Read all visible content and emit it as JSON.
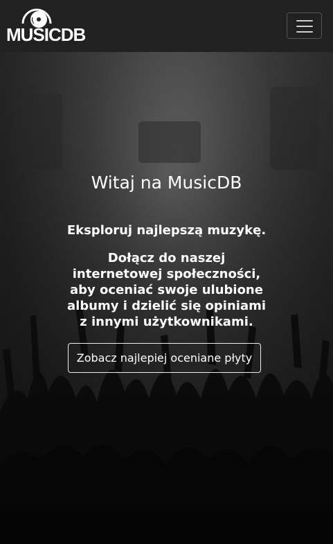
{
  "navbar": {
    "brand_text": "MUSICDB",
    "logo_icon": "vinyl-record-icon",
    "menu_icon": "hamburger-menu-icon"
  },
  "hero": {
    "title": "Witaj na MusicDB",
    "lead": "Eksploruj najlepszą muzykę.",
    "description": "Dołącz do naszej internetowej społeczności, aby oceniać swoje ulubione albumy i dzielić się opiniami z innymi użytkownikami.",
    "cta_label": "Zobacz najlepiej oceniane płyty"
  },
  "colors": {
    "navbar_bg": "#212121",
    "text": "#ffffff",
    "button_border": "#f0f0f0"
  }
}
